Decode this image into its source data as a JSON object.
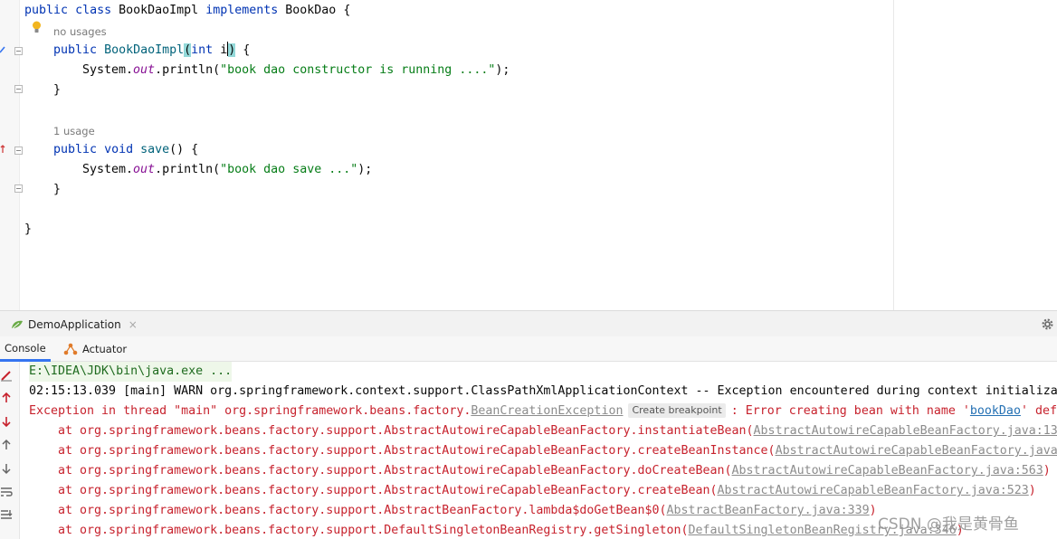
{
  "editor": {
    "line1": {
      "kw1": "public",
      "kw2": "class",
      "name": "BookDaoImpl",
      "kw3": "implements",
      "iface": "BookDao",
      "brace": "{"
    },
    "hint_no_usages": "no usages",
    "line2": {
      "kw": "public",
      "method": "BookDaoImpl",
      "open": "(",
      "ptype": "int",
      "pname": "i",
      "close": ")",
      "brace": " {"
    },
    "line3": {
      "obj": "System.",
      "field": "out",
      "call": ".println(",
      "str": "\"book dao constructor is running ....\"",
      "end": ");"
    },
    "line4": "}",
    "hint_usage": "1 usage",
    "line5": {
      "kw1": "public",
      "kw2": "void",
      "method": "save",
      "rest": "() {"
    },
    "line6": {
      "obj": "System.",
      "field": "out",
      "call": ".println(",
      "str": "\"book dao save ...\"",
      "end": ");"
    },
    "line7": "}",
    "line8": "}"
  },
  "run_window": {
    "tab_label": "DemoApplication",
    "tab_close": "×",
    "subtabs": {
      "console": "Console",
      "actuator": "Actuator"
    }
  },
  "console": {
    "cmd": "E:\\IDEA\\JDK\\bin\\java.exe ...",
    "warn": "02:15:13.039 [main] WARN org.springframework.context.support.ClassPathXmlApplicationContext -- Exception encountered during context initializa",
    "exc_prefix": "Exception in thread \"main\" org.springframework.beans.factory.",
    "exc_class": "BeanCreationException",
    "exc_badge": "Create breakpoint",
    "exc_mid": ": Error creating bean with name '",
    "exc_bean": "bookDao",
    "exc_suffix": "' def",
    "stack": [
      {
        "text": "    at org.springframework.beans.factory.support.AbstractAutowireCapableBeanFactory.instantiateBean(",
        "link": "AbstractAutowireCapableBeanFactory.java:13",
        "tail": ""
      },
      {
        "text": "    at org.springframework.beans.factory.support.AbstractAutowireCapableBeanFactory.createBeanInstance(",
        "link": "AbstractAutowireCapableBeanFactory.java",
        "tail": ""
      },
      {
        "text": "    at org.springframework.beans.factory.support.AbstractAutowireCapableBeanFactory.doCreateBean(",
        "link": "AbstractAutowireCapableBeanFactory.java:563",
        "tail": ")"
      },
      {
        "text": "    at org.springframework.beans.factory.support.AbstractAutowireCapableBeanFactory.createBean(",
        "link": "AbstractAutowireCapableBeanFactory.java:523",
        "tail": ")"
      },
      {
        "text": "    at org.springframework.beans.factory.support.AbstractBeanFactory.lambda$doGetBean$0(",
        "link": "AbstractBeanFactory.java:339",
        "tail": ")"
      },
      {
        "text": "    at org.springframework.beans.factory.support.DefaultSingletonBeanRegistry.getSingleton(",
        "link": "DefaultSingletonBeanRegistry.java:346",
        "tail": ")"
      }
    ]
  },
  "watermark": "CSDN @我是黄骨鱼",
  "colors": {
    "keyword": "#0033b3",
    "string": "#067d17",
    "field": "#871094",
    "error": "#c7222d",
    "accent": "#3574f0"
  },
  "icons": [
    "lightbulb-icon",
    "fold-icon",
    "implement-marker-icon",
    "run-config-icon",
    "gear-icon",
    "actuator-icon",
    "rerun-icon",
    "up-arrow-icon",
    "down-arrow-icon",
    "soft-wrap-icon",
    "scroll-end-icon"
  ]
}
